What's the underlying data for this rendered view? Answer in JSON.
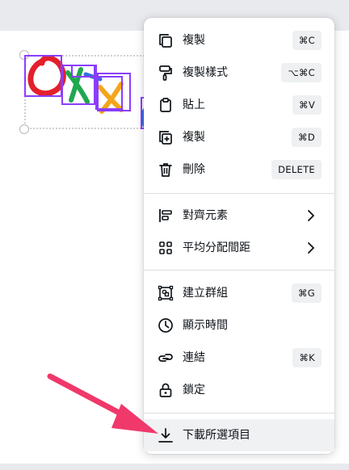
{
  "menu": {
    "items": [
      {
        "label": "複製",
        "shortcut": "⌘C",
        "icon": "copy-icon"
      },
      {
        "label": "複製樣式",
        "shortcut": "⌥⌘C",
        "icon": "paint-roller-icon"
      },
      {
        "label": "貼上",
        "shortcut": "⌘V",
        "icon": "clipboard-icon"
      },
      {
        "label": "複製",
        "shortcut": "⌘D",
        "icon": "duplicate-icon"
      },
      {
        "label": "刪除",
        "shortcut": "DELETE",
        "icon": "trash-icon"
      },
      {
        "label": "對齊元素",
        "submenu": true,
        "icon": "align-left-icon"
      },
      {
        "label": "平均分配間距",
        "submenu": true,
        "icon": "grid-icon"
      },
      {
        "label": "建立群組",
        "shortcut": "⌘G",
        "icon": "group-icon"
      },
      {
        "label": "顯示時間",
        "icon": "clock-icon"
      },
      {
        "label": "連結",
        "shortcut": "⌘K",
        "icon": "link-icon"
      },
      {
        "label": "鎖定",
        "icon": "lock-icon"
      },
      {
        "label": "下載所選項目",
        "icon": "download-icon",
        "highlighted": true
      }
    ]
  },
  "colors": {
    "selection": "#8b3dff",
    "arrow": "#f0386b",
    "stroke_red": "#e3202b",
    "stroke_green": "#1fa84f",
    "stroke_blue": "#2f6fe0",
    "stroke_orange": "#f4a51c"
  }
}
